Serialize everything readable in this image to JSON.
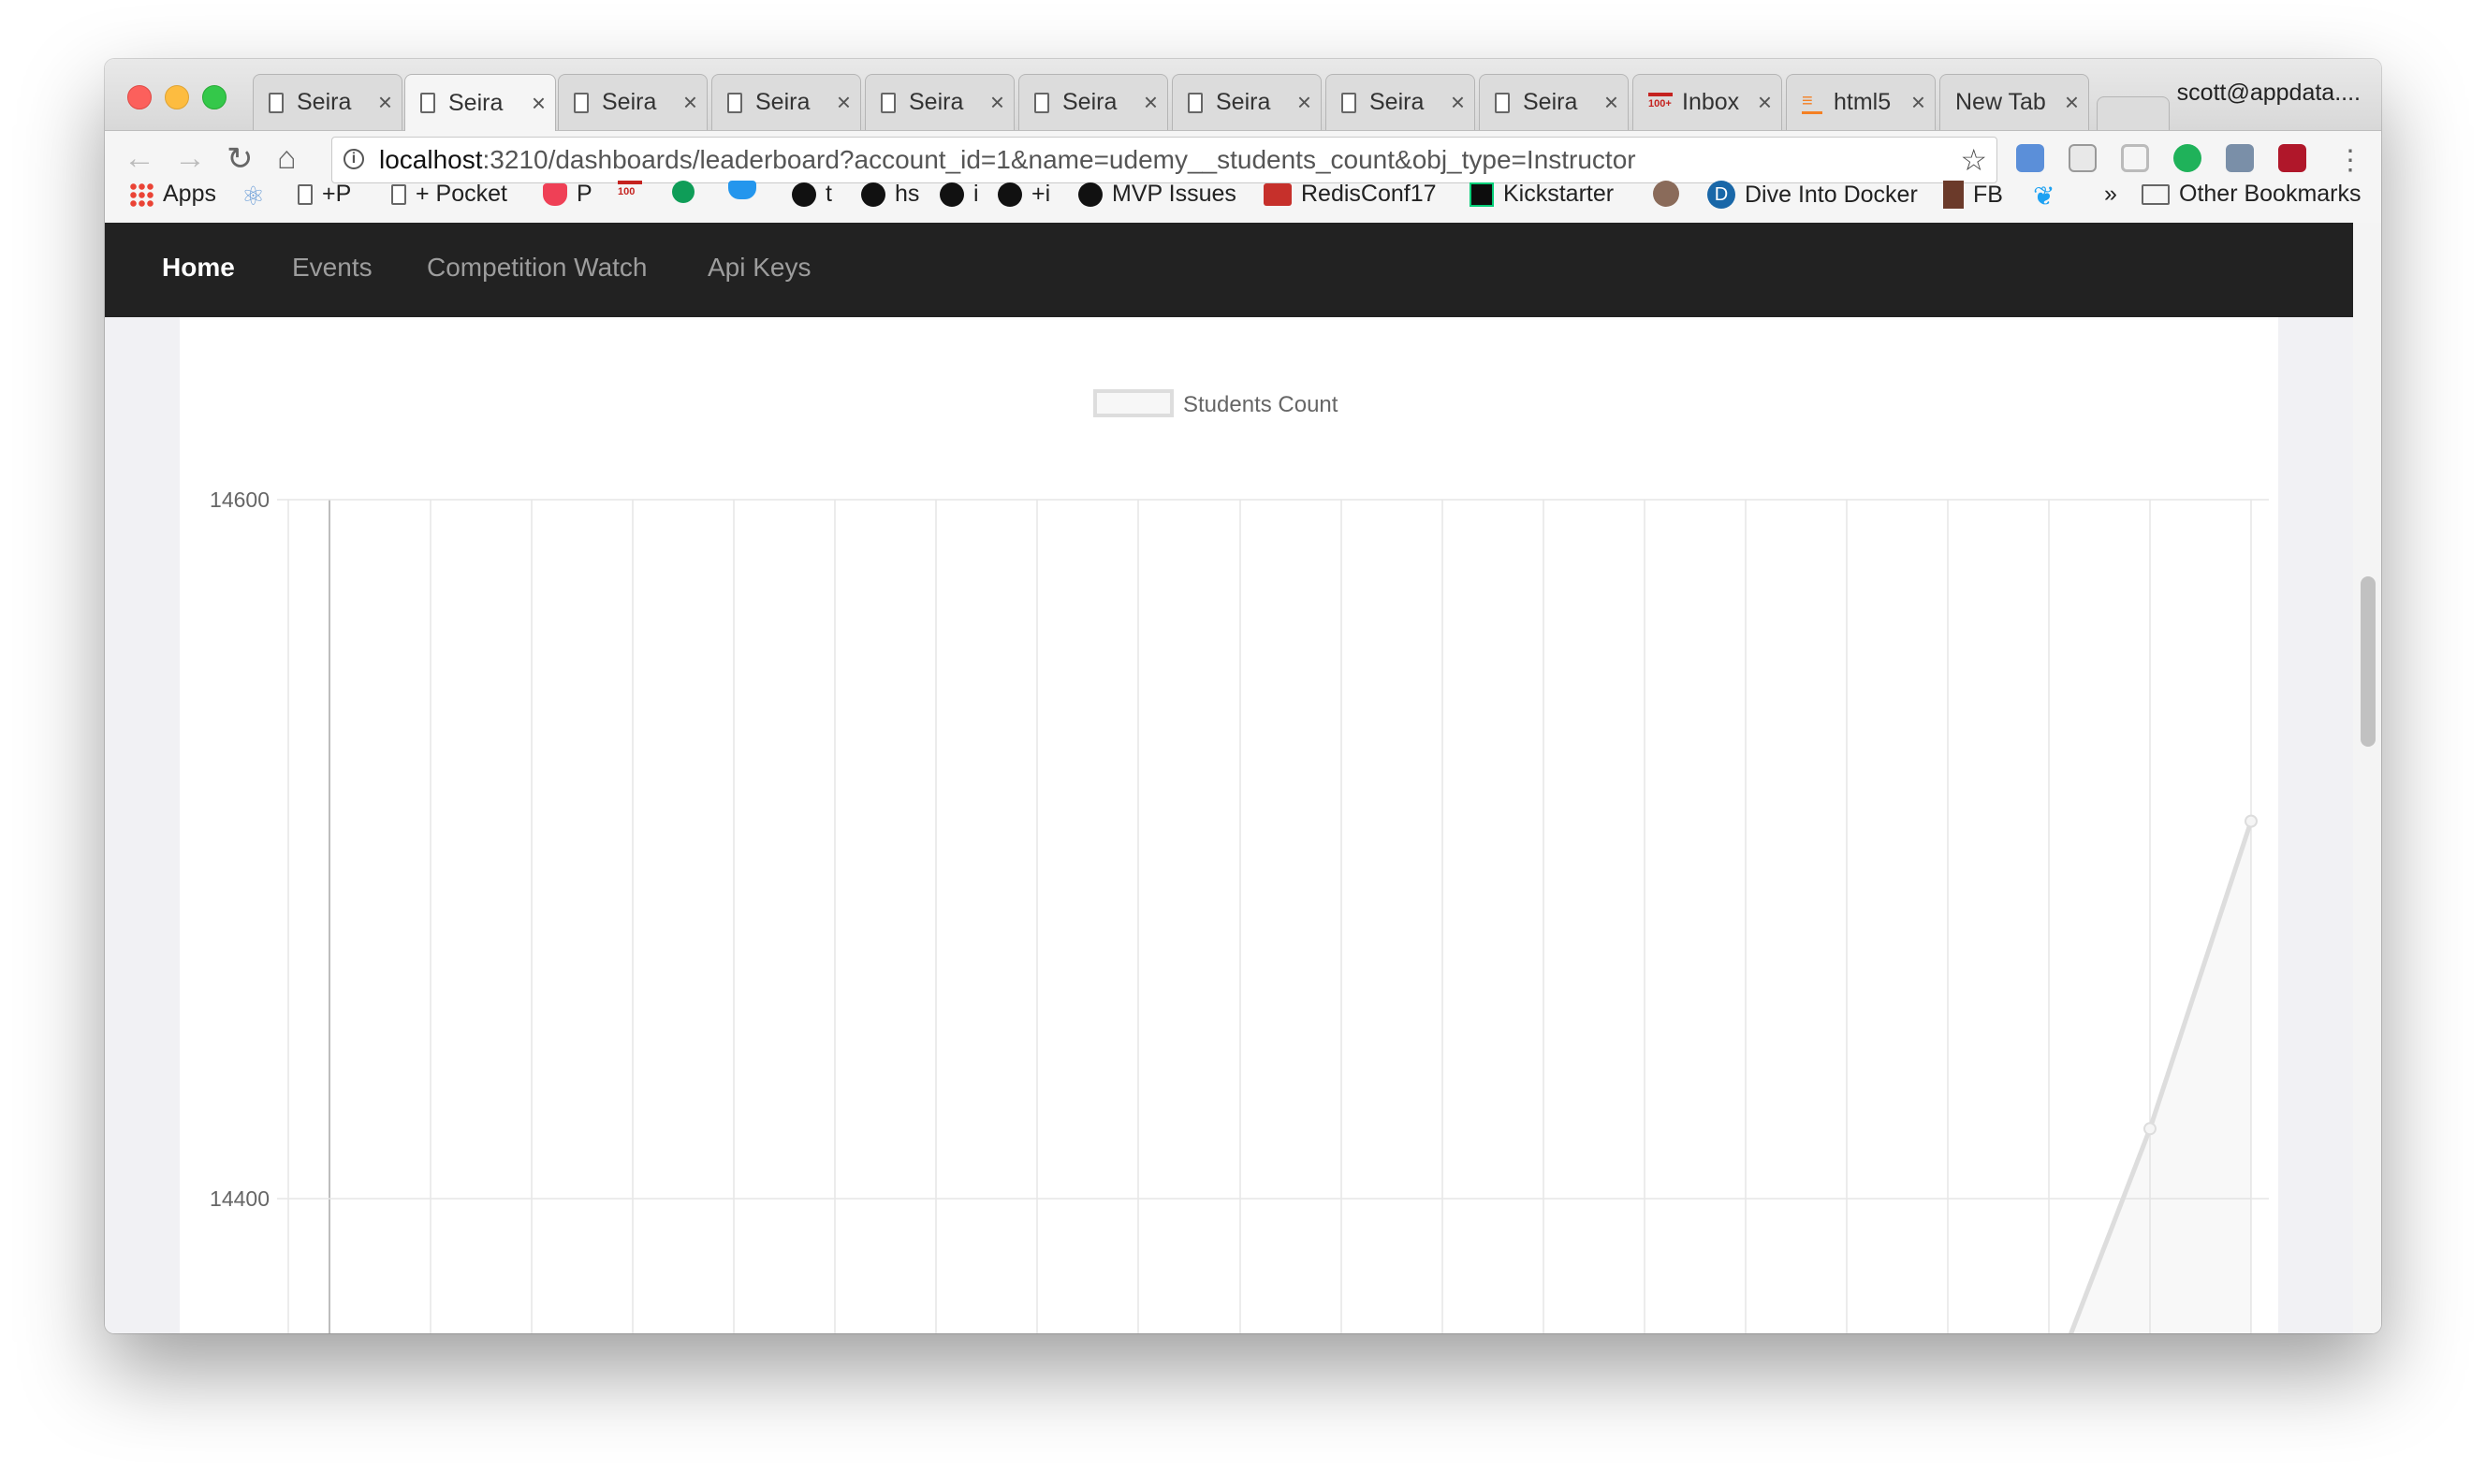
{
  "browser": {
    "tabs": [
      {
        "title": "Seira",
        "active": false
      },
      {
        "title": "Seira",
        "active": true
      },
      {
        "title": "Seira",
        "active": false
      },
      {
        "title": "Seira",
        "active": false
      },
      {
        "title": "Seira",
        "active": false
      },
      {
        "title": "Seira",
        "active": false
      },
      {
        "title": "Seira",
        "active": false
      },
      {
        "title": "Seira",
        "active": false
      },
      {
        "title": "Seira",
        "active": false
      },
      {
        "title": "Inbox",
        "active": false
      },
      {
        "title": "html5",
        "active": false
      },
      {
        "title": "New Tab",
        "active": false
      }
    ],
    "profile": "scott@appdata....",
    "url_host": "localhost",
    "url_rest": ":3210/dashboards/leaderboard?account_id=1&name=udemy__students_count&obj_type=Instructor",
    "bookmarks": [
      "Apps",
      "",
      "+P",
      "+ Pocket",
      "P",
      "",
      "",
      "",
      "t",
      "hs",
      "i",
      "+i",
      "MVP Issues",
      "RedisConf17",
      "Kickstarter",
      "",
      "Dive Into Docker",
      "FB",
      ""
    ],
    "overflow": "»",
    "other_bookmarks": "Other Bookmarks"
  },
  "app_nav": {
    "home": "Home",
    "events": "Events",
    "competition_watch": "Competition Watch",
    "api_keys": "Api Keys"
  },
  "chart_data": {
    "type": "line",
    "legend": [
      "Students Count"
    ],
    "legend_position": "top",
    "y_ticks": [
      "14600",
      "14400"
    ],
    "ylim": [
      14345,
      14600
    ],
    "grid": true,
    "series": [
      {
        "name": "Students Count",
        "color": "#dddddd",
        "points_visible": [
          {
            "x_index": 18,
            "y": 14345
          },
          {
            "x_index": 19,
            "y": 14420
          },
          {
            "x_index": 20,
            "y": 14508
          }
        ]
      }
    ]
  }
}
